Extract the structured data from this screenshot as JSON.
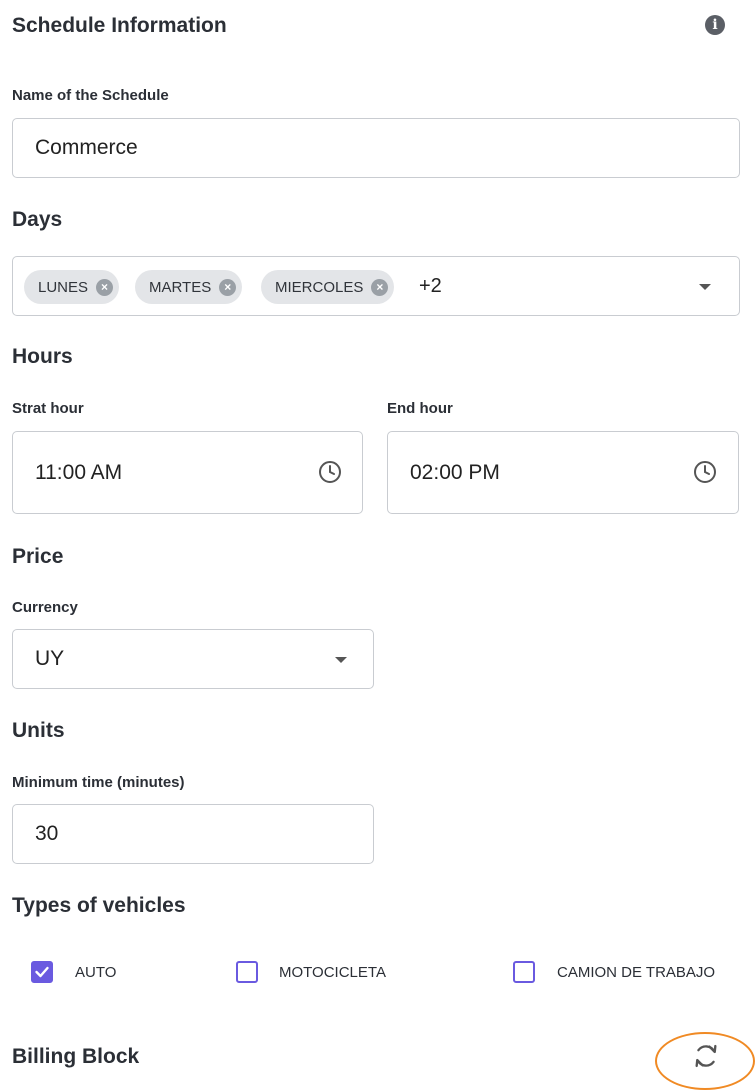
{
  "schedule": {
    "title": "Schedule Information",
    "name_label": "Name of the Schedule",
    "name_value": "Commerce"
  },
  "days": {
    "title": "Days",
    "chips": [
      "LUNES",
      "MARTES",
      "MIERCOLES"
    ],
    "more": "+2"
  },
  "hours": {
    "title": "Hours",
    "start_label": "Strat hour",
    "start_value": "11:00 AM",
    "end_label": "End hour",
    "end_value": "02:00 PM"
  },
  "price": {
    "title": "Price",
    "currency_label": "Currency",
    "currency_value": "UY"
  },
  "units": {
    "title": "Units",
    "min_time_label": "Minimum time (minutes)",
    "min_time_value": "30"
  },
  "vehicles": {
    "title": "Types of vehicles",
    "items": [
      {
        "label": "AUTO",
        "checked": true
      },
      {
        "label": "MOTOCICLETA",
        "checked": false
      },
      {
        "label": "CAMION DE TRABAJO",
        "checked": false
      }
    ]
  },
  "billing": {
    "title": "Billing Block"
  },
  "icons": {
    "info": "info-icon",
    "clock": "clock-icon",
    "refresh": "refresh-icon",
    "chip_remove": "chip-remove-icon",
    "dropdown": "chevron-down-icon"
  },
  "colors": {
    "accent": "#6a5ae0",
    "highlight_ring": "#f08a24"
  }
}
